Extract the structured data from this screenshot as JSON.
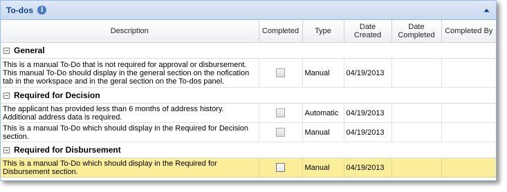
{
  "panel": {
    "title": "To-dos",
    "info_icon": "info-icon",
    "collapse_icon": "collapse-up-icon"
  },
  "columns": [
    "Description",
    "Completed",
    "Type",
    "Date Created",
    "Date Completed",
    "Completed By"
  ],
  "groups": [
    {
      "name": "General",
      "rows": [
        {
          "description": "This is a manual To-Do that is not required for approval or disbursement. This manual To-Do should display in the general section on the nofication tab in the workspace and in the geral section on the To-dos panel.",
          "completed": false,
          "type": "Manual",
          "date_created": "04/19/2013",
          "date_completed": "",
          "completed_by": ""
        }
      ]
    },
    {
      "name": "Required for Decision",
      "rows": [
        {
          "description": "The applicant has provided less than 6 months of address history. Additional address data is required.",
          "completed": false,
          "type": "Automatic",
          "date_created": "04/19/2013",
          "date_completed": "",
          "completed_by": ""
        },
        {
          "description": "This is a manual To-Do which should display in the Required for Decision section.",
          "completed": false,
          "type": "Manual",
          "date_created": "04/19/2013",
          "date_completed": "",
          "completed_by": ""
        }
      ]
    },
    {
      "name": "Required for Disbursement",
      "rows": [
        {
          "description": "This is a manual To-Do which should display in the Required for Disbursement section.",
          "completed": false,
          "type": "Manual",
          "date_created": "04/19/2013",
          "date_completed": "",
          "completed_by": "",
          "selected": true
        }
      ]
    }
  ],
  "colors": {
    "header_title": "#15428b",
    "selected_row": "#fbee9b",
    "panel_border": "#99bbe8"
  }
}
